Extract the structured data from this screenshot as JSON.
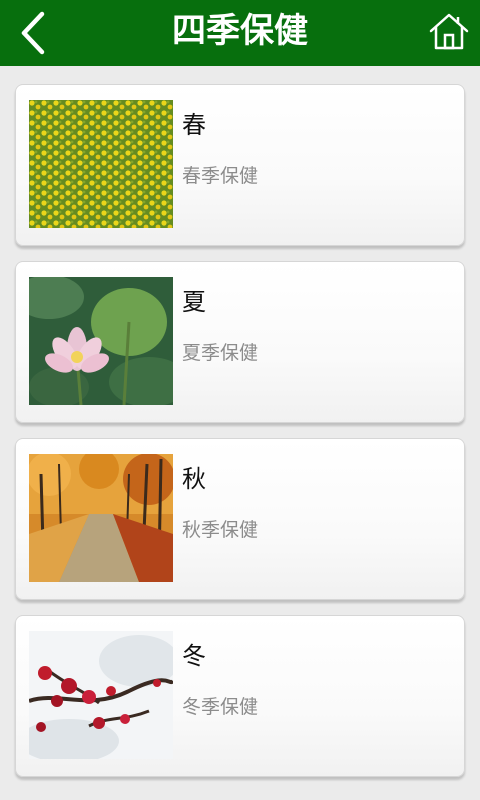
{
  "header": {
    "title": "四季保健",
    "back_icon": "chevron-left-icon",
    "home_icon": "home-icon",
    "background": "#076f0d"
  },
  "seasons": [
    {
      "name": "春",
      "subtitle": "春季保健",
      "image": "rapeseed-field-photo"
    },
    {
      "name": "夏",
      "subtitle": "夏季保健",
      "image": "lotus-flower-photo"
    },
    {
      "name": "秋",
      "subtitle": "秋季保健",
      "image": "autumn-forest-path-photo"
    },
    {
      "name": "冬",
      "subtitle": "冬季保健",
      "image": "plum-blossoms-in-snow-photo"
    }
  ]
}
